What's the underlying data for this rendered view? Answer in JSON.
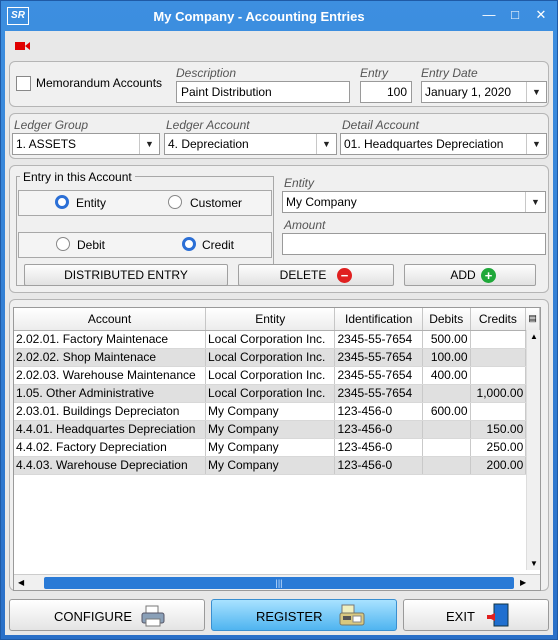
{
  "window": {
    "title": "My Company - Accounting Entries",
    "logo_text": "SR",
    "min_symbol": "—",
    "max_symbol": "□",
    "close_symbol": "✕"
  },
  "toolbar": {
    "record_icon": "video-camera-icon",
    "record_color": "#e00000"
  },
  "header": {
    "memorandum_label": "Memorandum Accounts",
    "memorandum_checked": false,
    "description_label": "Description",
    "description_value": "Paint Distribution",
    "entry_label": "Entry",
    "entry_value": "100",
    "entry_date_label": "Entry Date",
    "entry_date_value": "January 1, 2020"
  },
  "ledger": {
    "group_label": "Ledger Group",
    "group_value": "1. ASSETS",
    "account_label": "Ledger Account",
    "account_value": "4. Depreciation",
    "detail_label": "Detail Account",
    "detail_value": "01. Headquartes Depreciation"
  },
  "entry_account": {
    "group_title": "Entry in this Account",
    "entity_option": "Entity",
    "customer_option": "Customer",
    "selected_party": "Entity",
    "debit_option": "Debit",
    "credit_option": "Credit",
    "selected_side": "Credit",
    "entity_label": "Entity",
    "entity_value": "My Company",
    "amount_label": "Amount",
    "amount_value": "",
    "distributed_button": "DISTRIBUTED ENTRY",
    "delete_button": "DELETE",
    "add_button": "ADD"
  },
  "grid": {
    "columns": [
      "Account",
      "Entity",
      "Identification",
      "Debits",
      "Credits"
    ],
    "rows": [
      [
        "2.02.01. Factory Maintenace",
        "Local Corporation Inc.",
        "2345-55-7654",
        "500.00",
        ""
      ],
      [
        "2.02.02. Shop Maintenace",
        "Local Corporation Inc.",
        "2345-55-7654",
        "100.00",
        ""
      ],
      [
        "2.02.03. Warehouse Maintenance",
        "Local Corporation Inc.",
        "2345-55-7654",
        "400.00",
        ""
      ],
      [
        "1.05. Other Administrative",
        "Local Corporation Inc.",
        "2345-55-7654",
        "",
        "1,000.00"
      ],
      [
        "2.03.01. Buildings Depreciaton",
        "My Company",
        "123-456-0",
        "600.00",
        ""
      ],
      [
        "4.4.01. Headquartes Depreciation",
        "My Company",
        "123-456-0",
        "",
        "150.00"
      ],
      [
        "4.4.02. Factory Depreciation",
        "My Company",
        "123-456-0",
        "",
        "250.00"
      ],
      [
        "4.4.03. Warehouse Depreciation",
        "My Company",
        "123-456-0",
        "",
        "200.00"
      ]
    ],
    "scroll_grip": "|||"
  },
  "footer": {
    "configure_button": "CONFIGURE",
    "register_button": "REGISTER",
    "exit_button": "EXIT"
  },
  "colors": {
    "title_bar": "#2a70c8",
    "delete_icon": "#e02020",
    "add_icon": "#1fa83a",
    "register_button": "#4fb4f0",
    "scroll_thumb": "#2a7ad6"
  }
}
